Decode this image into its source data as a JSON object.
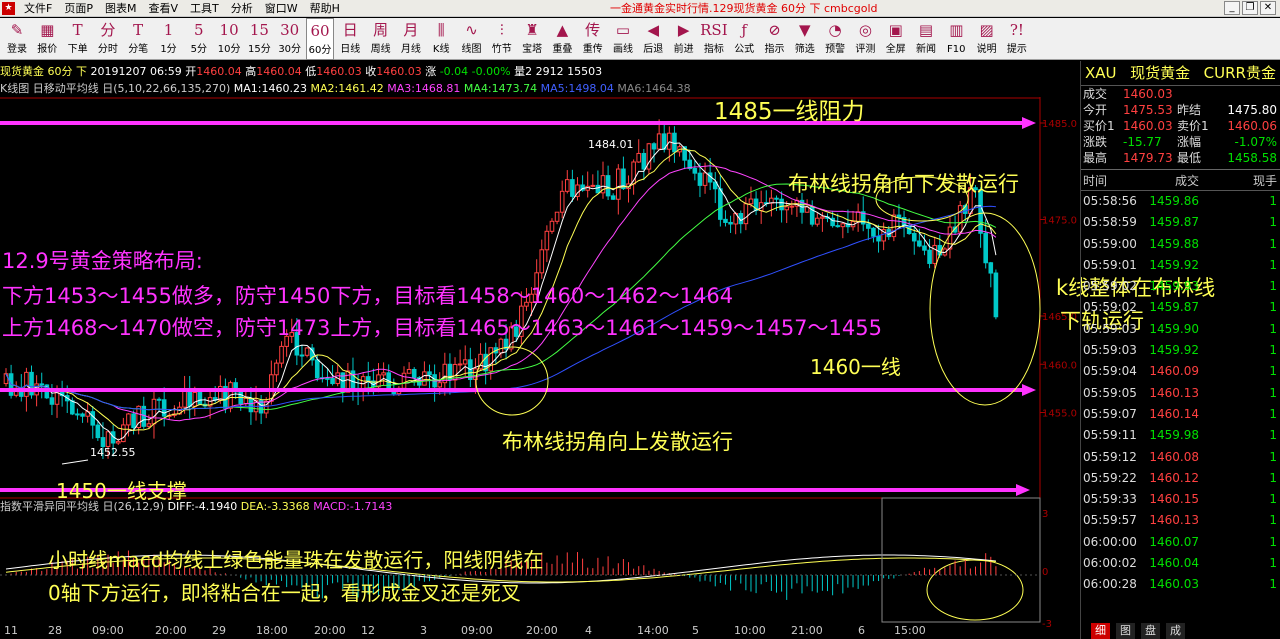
{
  "app": {
    "title": "一金通黄金实时行情.129现货黄金 60分 下 cmbcgold",
    "menu": [
      "文件F",
      "页面P",
      "图表M",
      "查看V",
      "工具T",
      "分析",
      "窗口W",
      "帮助H"
    ]
  },
  "toolbar": [
    {
      "g": "✎",
      "l": "登录"
    },
    {
      "g": "▦",
      "l": "报价"
    },
    {
      "g": "T",
      "l": "下单"
    },
    {
      "g": "分",
      "l": "分时"
    },
    {
      "g": "T",
      "l": "分笔"
    },
    {
      "g": "1",
      "l": "1分"
    },
    {
      "g": "5",
      "l": "5分"
    },
    {
      "g": "10",
      "l": "10分"
    },
    {
      "g": "15",
      "l": "15分"
    },
    {
      "g": "30",
      "l": "30分"
    },
    {
      "g": "60",
      "l": "60分",
      "sel": true
    },
    {
      "g": "日",
      "l": "日线"
    },
    {
      "g": "周",
      "l": "周线"
    },
    {
      "g": "月",
      "l": "月线"
    },
    {
      "g": "⫼",
      "l": "K线"
    },
    {
      "g": "∿",
      "l": "线图"
    },
    {
      "g": "⫶",
      "l": "竹节"
    },
    {
      "g": "♜",
      "l": "宝塔"
    },
    {
      "g": "▲",
      "l": "重叠"
    },
    {
      "g": "传",
      "l": "重传"
    },
    {
      "g": "▭",
      "l": "画线"
    },
    {
      "g": "◀",
      "l": "后退"
    },
    {
      "g": "▶",
      "l": "前进"
    },
    {
      "g": "RSI",
      "l": "指标"
    },
    {
      "g": "ƒ",
      "l": "公式"
    },
    {
      "g": "⊘",
      "l": "指示"
    },
    {
      "g": "▼",
      "l": "筛选"
    },
    {
      "g": "◔",
      "l": "预警"
    },
    {
      "g": "◎",
      "l": "评测"
    },
    {
      "g": "▣",
      "l": "全屏"
    },
    {
      "g": "▤",
      "l": "新闻"
    },
    {
      "g": "▥",
      "l": "F10"
    },
    {
      "g": "▨",
      "l": "说明"
    },
    {
      "g": "?!",
      "l": "提示"
    }
  ],
  "status": {
    "name": "现货黄金 60分 下",
    "date": "20191207",
    "time": "06:59",
    "open_l": "开",
    "open": "1460.04",
    "high_l": "高",
    "high": "1460.04",
    "low_l": "低",
    "low": "1460.03",
    "close_l": "收",
    "close": "1460.03",
    "chg_l": "涨",
    "chg": "-0.04",
    "pct": "-0.00%",
    "vol_l": "量",
    "vol": "2",
    "amount": "2912",
    "oi": "15503"
  },
  "ma": {
    "label": "K线图 日移动平均线 日(5,10,22,66,135,270)",
    "ma1": "MA1:1460.23",
    "ma2": "MA2:1461.42",
    "ma3": "MA3:1468.81",
    "ma4": "MA4:1473.74",
    "ma5": "MA5:1498.04",
    "ma6": "MA6:1464.38"
  },
  "macd": {
    "label": "指数平滑异同平均线 日(26,12,9)",
    "diff": "DIFF:-4.1940",
    "dea": "DEA:-3.3368",
    "macd": "MACD:-1.7143"
  },
  "sidebar": {
    "head": {
      "code": "XAU",
      "name": "现货黄金",
      "cat": "CURR贵金"
    },
    "quote": [
      {
        "a": "成交",
        "b": "1460.03",
        "bc": "red",
        "c": "",
        "d": "",
        "dc": "red"
      },
      {
        "a": "今开",
        "b": "1475.53",
        "bc": "red",
        "c": "昨结",
        "d": "1475.80",
        "dc": "white"
      },
      {
        "a": "买价1",
        "b": "1460.03",
        "bc": "red",
        "c": "卖价1",
        "d": "1460.06",
        "dc": "red"
      },
      {
        "a": "涨跌",
        "b": "-15.77",
        "bc": "green",
        "c": "涨幅",
        "d": "-1.07%",
        "dc": "green"
      },
      {
        "a": "最高",
        "b": "1479.73",
        "bc": "red",
        "c": "最低",
        "d": "1458.58",
        "dc": "green"
      }
    ],
    "trade_head": {
      "t": "时间",
      "p": "成交",
      "v": "现手"
    },
    "trades": [
      {
        "t": "05:58:56",
        "p": "1459.86",
        "v": "1",
        "c": "green"
      },
      {
        "t": "05:58:59",
        "p": "1459.87",
        "v": "1",
        "c": "green"
      },
      {
        "t": "05:59:00",
        "p": "1459.88",
        "v": "1",
        "c": "green"
      },
      {
        "t": "05:59:01",
        "p": "1459.92",
        "v": "1",
        "c": "green"
      },
      {
        "t": "05:59:02",
        "p": "1459.93",
        "v": "1",
        "c": "green"
      },
      {
        "t": "05:59:02",
        "p": "1459.87",
        "v": "1",
        "c": "green"
      },
      {
        "t": "05:59:03",
        "p": "1459.90",
        "v": "1",
        "c": "green"
      },
      {
        "t": "05:59:03",
        "p": "1459.92",
        "v": "1",
        "c": "green"
      },
      {
        "t": "05:59:04",
        "p": "1460.09",
        "v": "1",
        "c": "red"
      },
      {
        "t": "05:59:05",
        "p": "1460.13",
        "v": "1",
        "c": "red"
      },
      {
        "t": "05:59:07",
        "p": "1460.14",
        "v": "1",
        "c": "red"
      },
      {
        "t": "05:59:11",
        "p": "1459.98",
        "v": "1",
        "c": "green"
      },
      {
        "t": "05:59:12",
        "p": "1460.08",
        "v": "1",
        "c": "red"
      },
      {
        "t": "05:59:22",
        "p": "1460.12",
        "v": "1",
        "c": "red"
      },
      {
        "t": "05:59:33",
        "p": "1460.15",
        "v": "1",
        "c": "red"
      },
      {
        "t": "05:59:57",
        "p": "1460.13",
        "v": "1",
        "c": "red"
      },
      {
        "t": "06:00:00",
        "p": "1460.07",
        "v": "1",
        "c": "green"
      },
      {
        "t": "06:00:02",
        "p": "1460.04",
        "v": "1",
        "c": "green"
      },
      {
        "t": "06:00:28",
        "p": "1460.03",
        "v": "1",
        "c": "green"
      }
    ],
    "tabs": [
      "细",
      "图",
      "盘",
      "成"
    ]
  },
  "price_axis": [
    "1485.0",
    "1475.0",
    "1465.0",
    "1460.0",
    "1455.0"
  ],
  "macd_axis": [
    "3",
    "0",
    "-3"
  ],
  "x_axis": [
    "11",
    "28",
    "09:00",
    "20:00",
    "29",
    "18:00",
    "20:00",
    "12",
    "3",
    "09:00",
    "20:00",
    "4",
    "14:00",
    "5",
    "10:00",
    "21:00",
    "6",
    "15:00"
  ],
  "annotations": {
    "resist": "1485一线阻力",
    "support": "1450一线支撑",
    "line1460": "1460一线",
    "boll_down": "布林线拐角向下发散运行",
    "boll_up": "布林线拐角向上发散运行",
    "kline_l1": "k线整体在布林线",
    "kline_l2": "下轨运行",
    "strat_title": "12.9号黄金策略布局:",
    "strat_1": "下方1453～1455做多，防守1450下方，目标看1458～1460～1462～1464",
    "strat_2": "上方1468～1470做空，防守1473上方，目标看1465～1463～1461～1459～1457～1455",
    "macd_1": "小时线macd均线上绿色能量珠在发散运行，阳线阴线在",
    "macd_2": "0轴下方运行，即将粘合在一起，看形成金叉还是死叉",
    "low_label": "1452.55",
    "high_label": "1484.01"
  },
  "colors": {
    "up": "#ff4040",
    "down": "#00c8c8",
    "magenta": "#ff33ff",
    "yellow": "#ffff55"
  }
}
